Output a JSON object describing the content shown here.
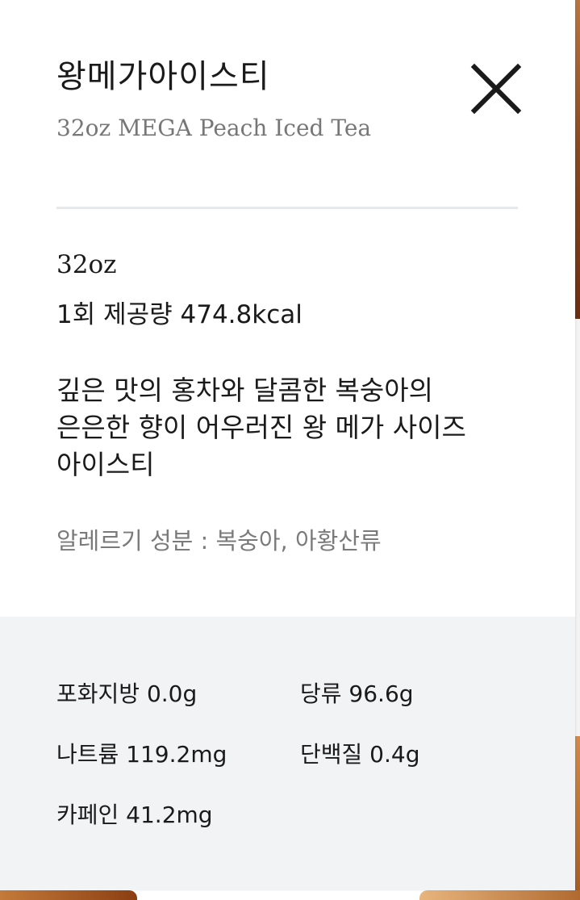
{
  "product": {
    "name_ko": "왕메가아이스티",
    "name_en": "32oz MEGA Peach Iced Tea",
    "size": "32oz",
    "serving": "1회 제공량 474.8kcal",
    "description_lines": [
      "깊은 맛의 홍차와 달콤한 복숭아의",
      "은은한 향이 어우러진 왕 메가 사이즈",
      "아이스티"
    ],
    "allergy": "알레르기 성분 : 복숭아, 아황산류"
  },
  "nutrition": {
    "saturated_fat": "포화지방 0.0g",
    "sugar": "당류 96.6g",
    "sodium": "나트륨 119.2mg",
    "protein": "단백질 0.4g",
    "caffeine": "카페인 41.2mg"
  },
  "icons": {
    "close": "close-icon"
  },
  "colors": {
    "text_primary": "#1a1a1a",
    "text_secondary": "#777777",
    "divider": "#e7e8ea",
    "nutrition_bg": "#f2f3f5"
  }
}
